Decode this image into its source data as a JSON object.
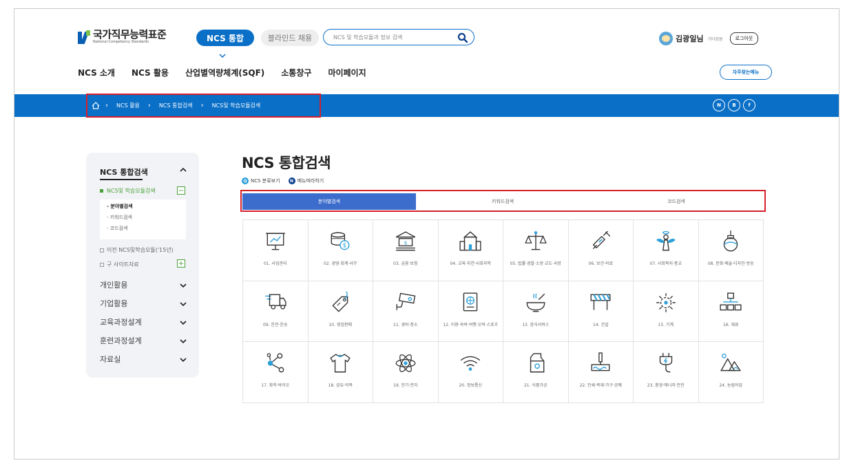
{
  "header": {
    "logo_kr": "국가직무능력표준",
    "logo_en": "National Competency Standards",
    "pill_ncs": "NCS 통합",
    "pill_blind": "블라인드 채용",
    "search_placeholder": "NCS 및 학습모듈과 정보 검색",
    "user_name": "김광일님",
    "user_role": "기타회원",
    "logout": "로그아웃",
    "gnb": [
      "NCS 소개",
      "NCS 활용",
      "산업별역량체계(SQF)",
      "소통창구",
      "마이페이지"
    ],
    "faq": "자주찾는메뉴"
  },
  "breadcrumb": {
    "items": [
      "NCS 활용",
      "NCS 통합검색",
      "NCS및 학습모듈검색"
    ],
    "social": [
      "N",
      "B",
      "f"
    ]
  },
  "sidebar": {
    "title": "NCS 통합검색",
    "active": "NCS및 학습모듈검색",
    "sub": [
      "분야별검색",
      "키워드검색",
      "코드검색"
    ],
    "old": "이전 NCS및학습모듈('15년)",
    "old_site": "구 사이트자료",
    "cats": [
      "개인활용",
      "기업활용",
      "교육과정설계",
      "훈련과정설계",
      "자료실"
    ]
  },
  "main": {
    "title": "NCS 통합검색",
    "link1": "NCS 분류보기",
    "link2": "메뉴따라하기",
    "tabs": [
      "분야별검색",
      "키워드검색",
      "코드검색"
    ],
    "categories": [
      {
        "label": "01. 사업관리",
        "icon": "presentation-board-icon"
      },
      {
        "label": "02. 경영·회계·사무",
        "icon": "coins-icon"
      },
      {
        "label": "03. 금융·보험",
        "icon": "bank-icon"
      },
      {
        "label": "04. 교육·자연·사회과학",
        "icon": "school-building-icon"
      },
      {
        "label": "05. 법률·경찰·소방·교도·국방",
        "icon": "scales-icon"
      },
      {
        "label": "06. 보건·의료",
        "icon": "syringe-icon"
      },
      {
        "label": "07. 사회복지·종교",
        "icon": "angel-icon"
      },
      {
        "label": "08. 문화·예술·디자인·방송",
        "icon": "ornament-icon"
      },
      {
        "label": "09. 운전·운송",
        "icon": "truck-icon"
      },
      {
        "label": "10. 영업판매",
        "icon": "price-tag-icon"
      },
      {
        "label": "11. 경비·청소",
        "icon": "cctv-icon"
      },
      {
        "label": "12. 이용·숙박·여행·오락·스포츠",
        "icon": "passport-icon"
      },
      {
        "label": "13. 음식서비스",
        "icon": "bowl-icon"
      },
      {
        "label": "14. 건설",
        "icon": "barrier-icon"
      },
      {
        "label": "15. 기계",
        "icon": "gear-icon"
      },
      {
        "label": "16. 재료",
        "icon": "hierarchy-icon"
      },
      {
        "label": "17. 화학·바이오",
        "icon": "molecule-icon"
      },
      {
        "label": "18. 섬유·의복",
        "icon": "tshirt-icon"
      },
      {
        "label": "19. 전기·전자",
        "icon": "atom-icon"
      },
      {
        "label": "20. 정보통신",
        "icon": "wifi-icon"
      },
      {
        "label": "21. 식품가공",
        "icon": "milk-carton-icon"
      },
      {
        "label": "22. 인쇄·목재·가구·공예",
        "icon": "paint-roller-icon"
      },
      {
        "label": "23. 환경·에너지·안전",
        "icon": "plug-icon"
      },
      {
        "label": "24. 농림어업",
        "icon": "mountain-icon"
      }
    ]
  },
  "colors": {
    "primary": "#0a6fc7",
    "tab_active": "#3c6ccc",
    "green": "#4ba03a",
    "highlight": "#d6202a"
  }
}
